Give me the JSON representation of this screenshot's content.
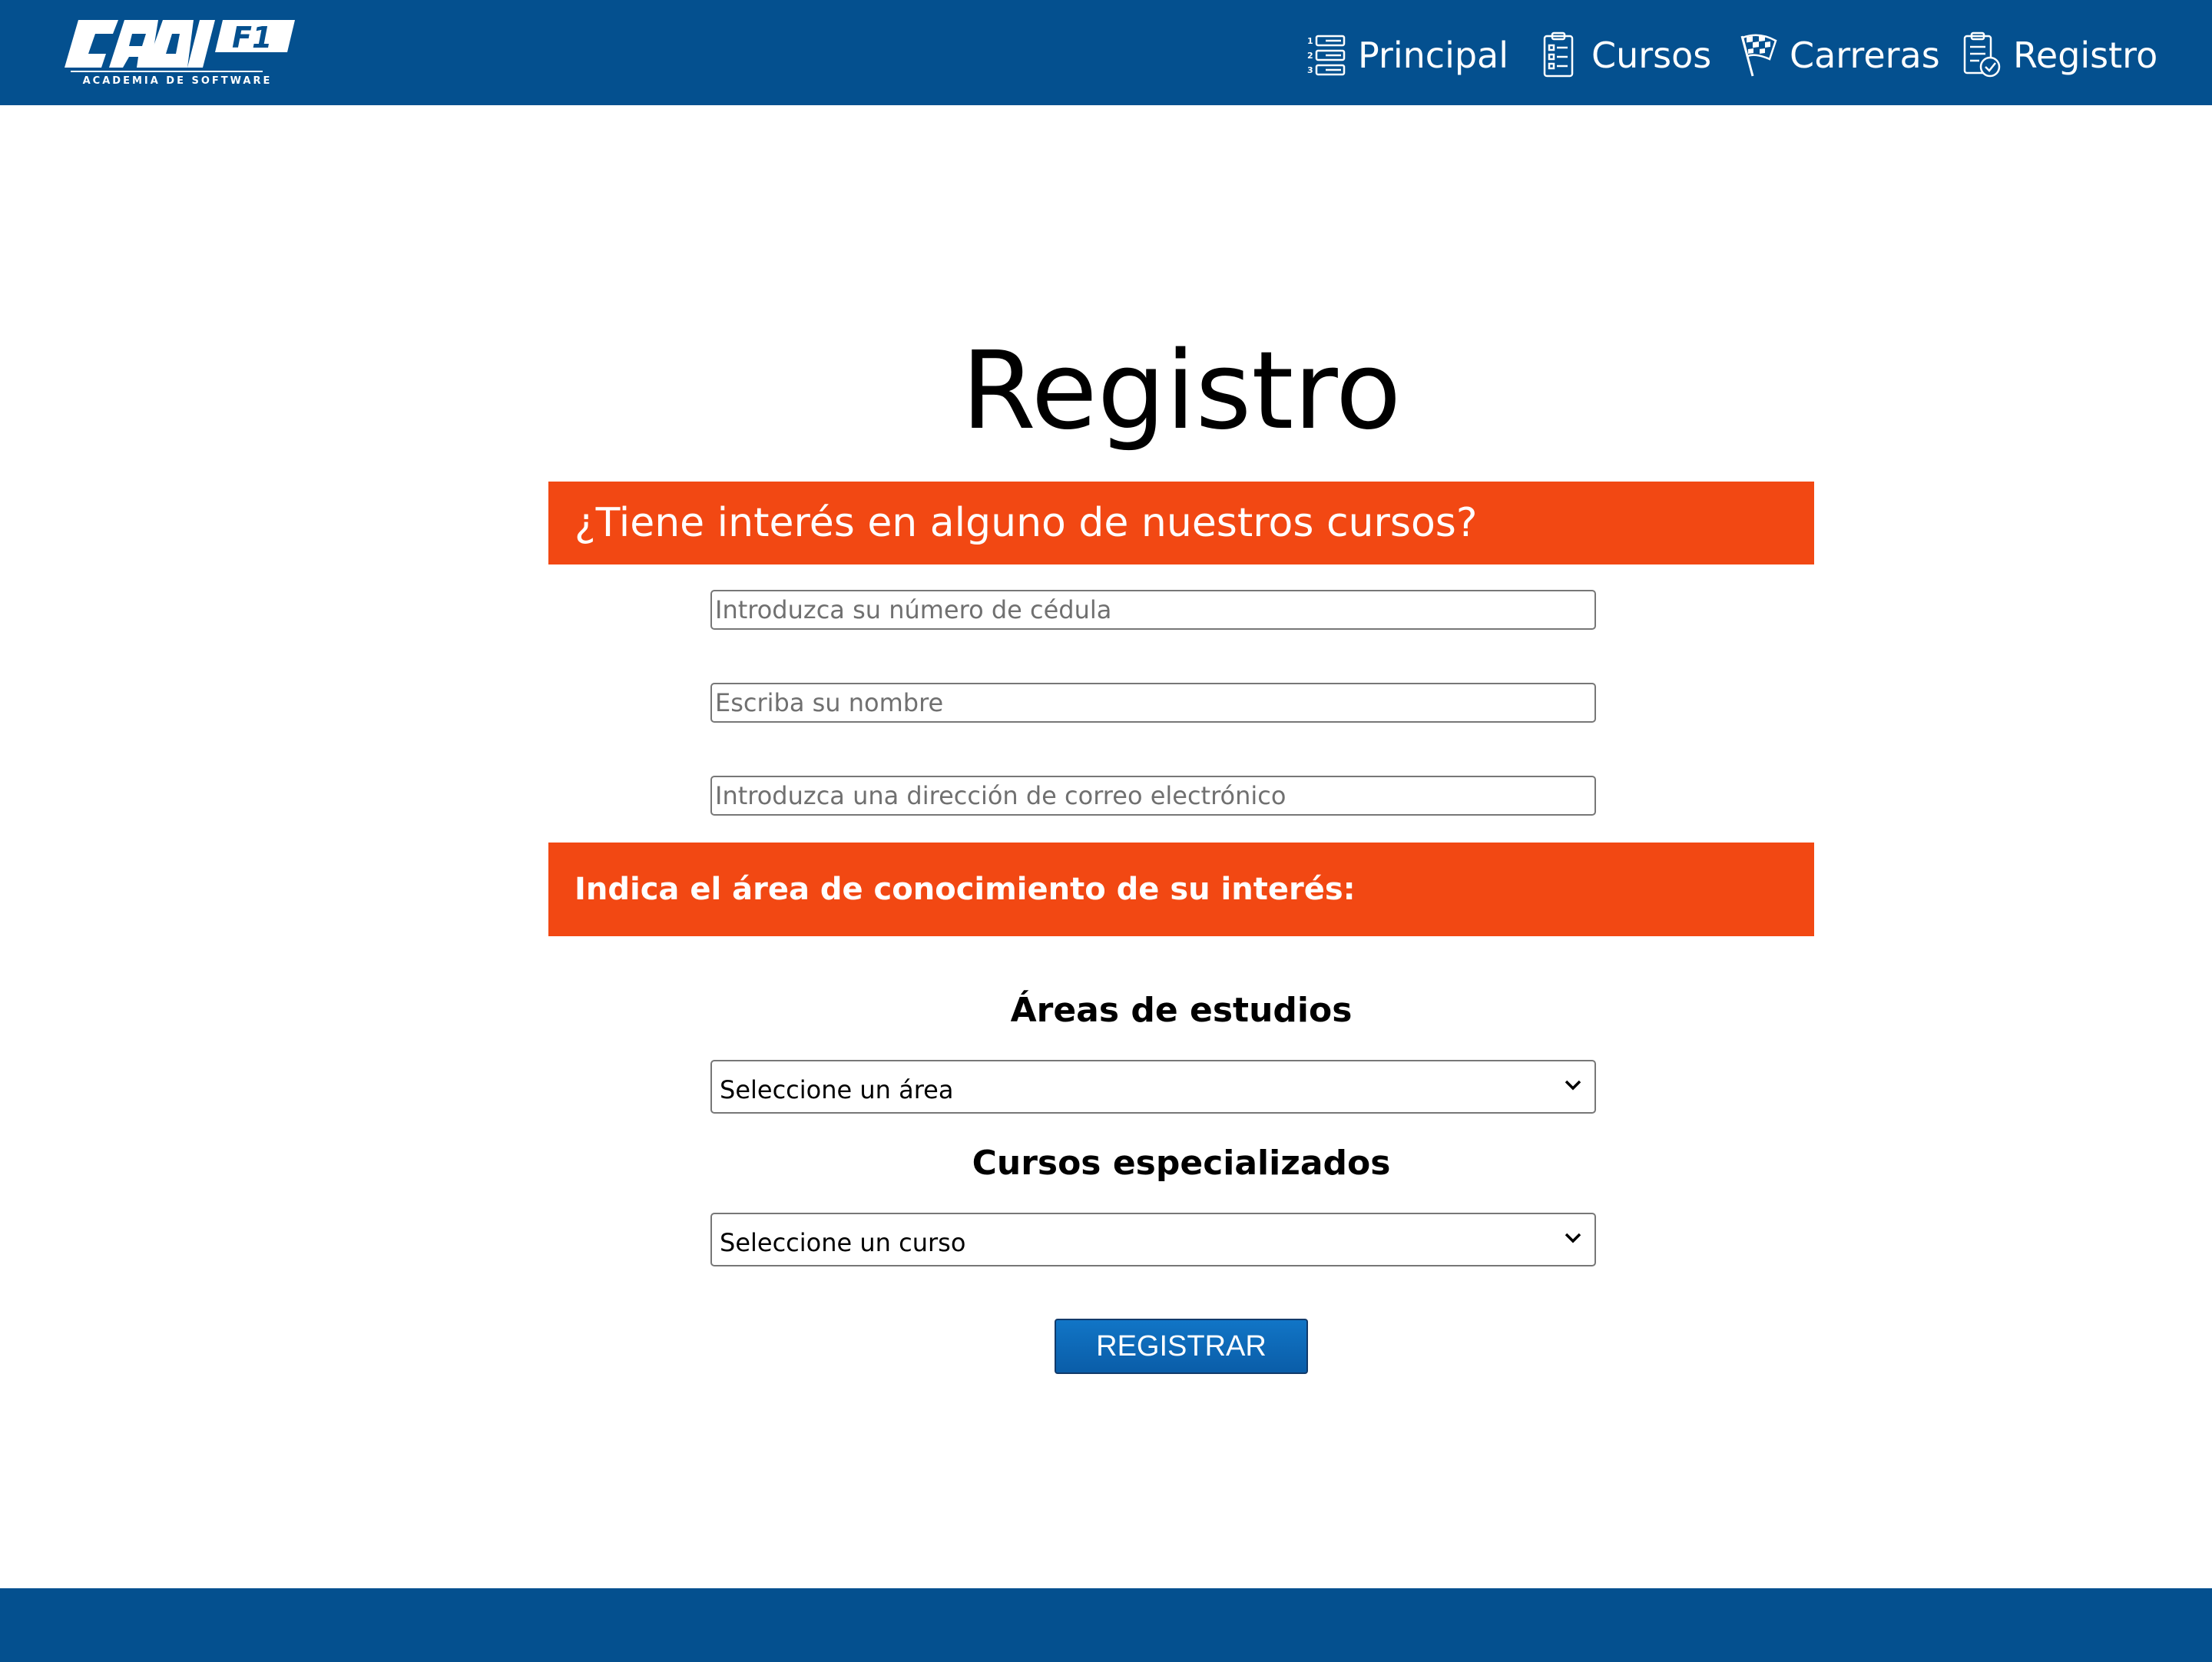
{
  "brand": {
    "logo_text": "CADIF1",
    "tagline": "ACADEMIA DE SOFTWARE"
  },
  "nav": {
    "items": [
      {
        "label": "Principal",
        "icon": "numbered-list-icon"
      },
      {
        "label": "Cursos",
        "icon": "clipboard-checklist-icon"
      },
      {
        "label": "Carreras",
        "icon": "checkered-flag-icon"
      },
      {
        "label": "Registro",
        "icon": "clipboard-check-icon"
      }
    ]
  },
  "page": {
    "title": "Registro"
  },
  "form": {
    "banner_interest": "¿Tiene interés en alguno de nuestros cursos?",
    "cedula_placeholder": "Introduzca su número de cédula",
    "nombre_placeholder": "Escriba su nombre",
    "email_placeholder": "Introduzca una dirección de correo electrónico",
    "banner_area": "Indica el área de conocimiento de su interés:",
    "areas_label": "Áreas de estudios",
    "area_selected": "Seleccione un área",
    "cursos_label": "Cursos especializados",
    "curso_selected": "Seleccione un curso",
    "submit_label": "REGISTRAR"
  },
  "colors": {
    "header_blue": "#04508f",
    "banner_orange": "#f24813",
    "button_blue": "#0a66b4"
  }
}
